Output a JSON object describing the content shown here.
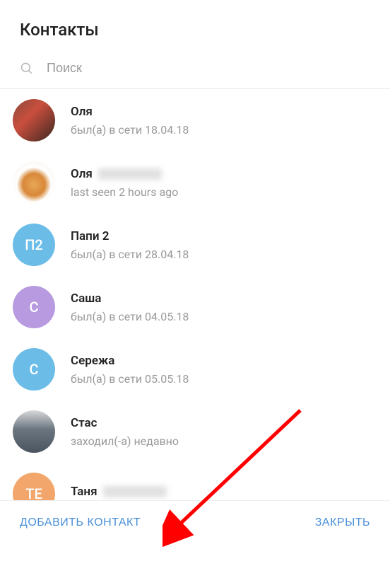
{
  "header": {
    "title": "Контакты"
  },
  "search": {
    "placeholder": "Поиск"
  },
  "contacts": [
    {
      "name": "Оля",
      "status": "был(а) в сети 18.04.18",
      "avatar_type": "photo1",
      "initials": ""
    },
    {
      "name": "Оля",
      "name_blurred": true,
      "status": "last seen 2 hours ago",
      "avatar_type": "photo2",
      "initials": ""
    },
    {
      "name": "Папи 2",
      "status": "был(а) в сети 28.04.18",
      "avatar_type": "initials",
      "avatar_bg": "#6bbde8",
      "initials": "П2"
    },
    {
      "name": "Саша",
      "status": "был(а) в сети 04.05.18",
      "avatar_type": "initials",
      "avatar_bg": "#b89ae0",
      "initials": "С"
    },
    {
      "name": "Сережа",
      "status": "был(а) в сети 05.05.18",
      "avatar_type": "initials",
      "avatar_bg": "#6bbde8",
      "initials": "С"
    },
    {
      "name": "Стас",
      "status": "заходил(-а) недавно",
      "avatar_type": "photo3",
      "initials": ""
    },
    {
      "name": "Таня",
      "name_blurred": true,
      "status": "",
      "avatar_type": "initials",
      "avatar_bg": "#f2a66b",
      "initials": "ТЕ"
    }
  ],
  "footer": {
    "add_contact": "ДОБАВИТЬ КОНТАКТ",
    "close": "ЗАКРЫТЬ"
  }
}
